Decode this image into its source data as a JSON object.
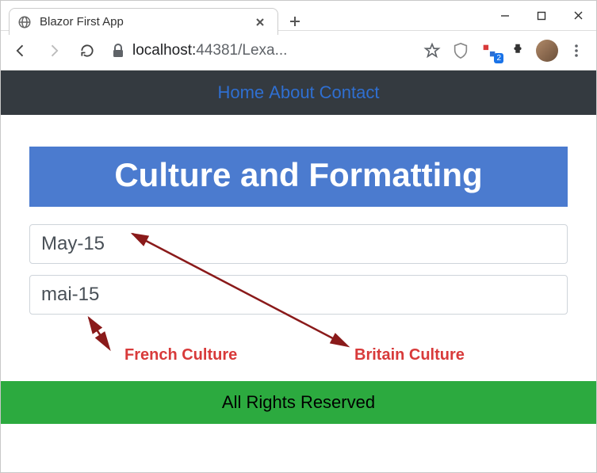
{
  "window": {
    "tab_title": "Blazor First App"
  },
  "browser": {
    "host": "localhost:",
    "port_path": "44381/Lexa...",
    "badge_count": "2"
  },
  "nav": {
    "home": "Home",
    "about": "About",
    "contact": "Contact"
  },
  "page": {
    "heading": "Culture and Formatting",
    "field_gb": "May-15",
    "field_fr": "mai-15",
    "footer": "All Rights Reserved"
  },
  "annotations": {
    "french": "French Culture",
    "britain": "Britain Culture"
  }
}
